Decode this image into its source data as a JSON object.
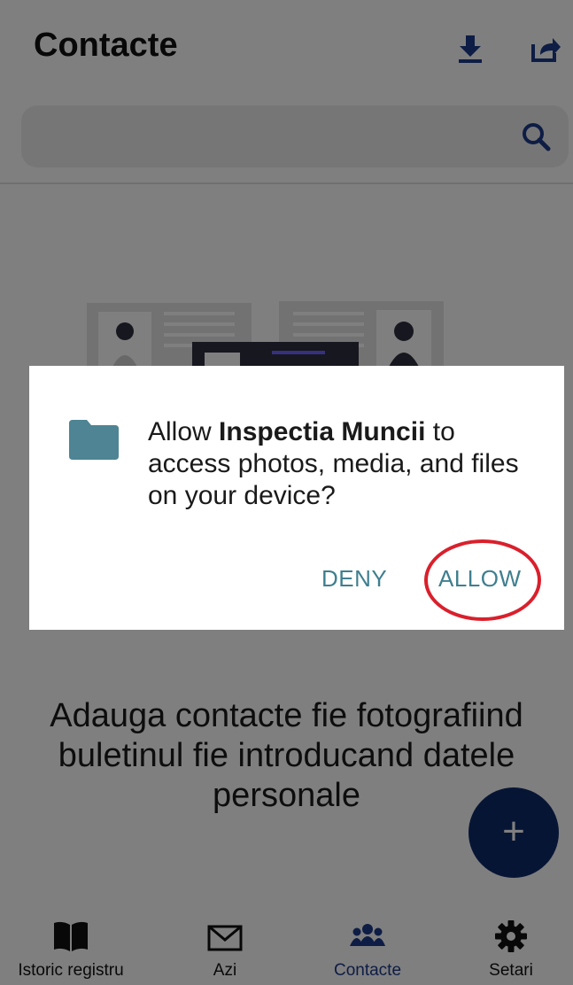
{
  "app": {
    "title": "Contacte"
  },
  "header": {
    "icons": [
      "download-icon",
      "share-icon"
    ]
  },
  "search": {
    "placeholder": "",
    "icon": "search-icon"
  },
  "empty_state": {
    "message": "Adauga contacte fie fotografiind buletinul fie introducand datele personale"
  },
  "fab": {
    "label": "+"
  },
  "bottom_nav": {
    "items": [
      {
        "label": "Istoric registru",
        "icon": "book-icon",
        "active": false
      },
      {
        "label": "Azi",
        "icon": "mail-icon",
        "active": false
      },
      {
        "label": "Contacte",
        "icon": "people-icon",
        "active": true
      },
      {
        "label": "Setari",
        "icon": "gear-icon",
        "active": false
      }
    ]
  },
  "dialog": {
    "text_prefix": "Allow ",
    "app_name": "Inspectia Muncii",
    "text_suffix": " to access photos, media, and files on your device?",
    "deny_label": "DENY",
    "allow_label": "ALLOW",
    "icon": "folder-icon"
  },
  "colors": {
    "accent": "#1d3a8a",
    "fab": "#0f2a6b",
    "dialog_button": "#3f7f8f",
    "folder": "#4e8493",
    "highlight": "#d9202c"
  }
}
